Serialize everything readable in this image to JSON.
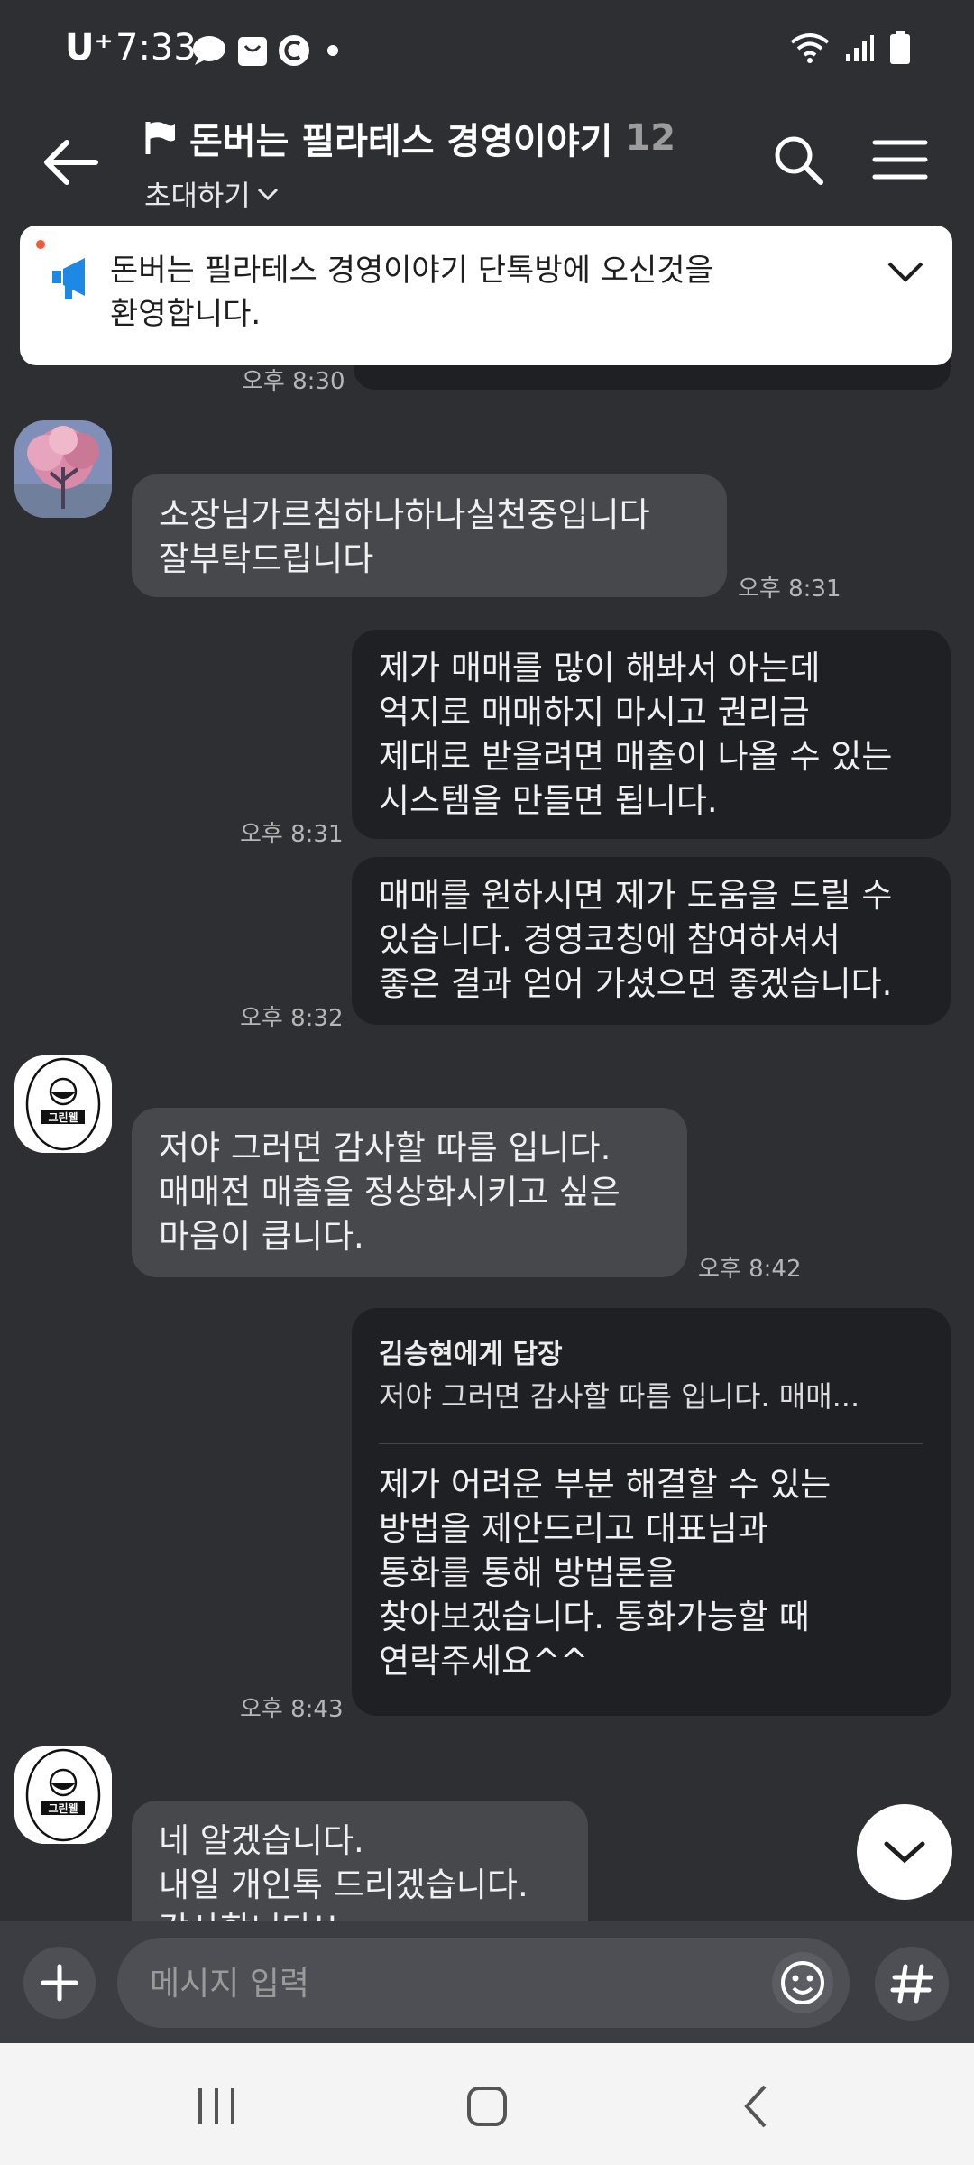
{
  "status_bar": {
    "carrier": "U⁺",
    "time": "7:33",
    "left_icons": [
      "chat-bubble-icon",
      "shopping-bag-icon",
      "c-circle-icon",
      "dot-icon"
    ],
    "right_icons": [
      "wifi-icon",
      "signal-icon",
      "battery-icon"
    ]
  },
  "header": {
    "title": "돈버는 필라테스 경영이야기",
    "member_count": "12",
    "invite_label": "초대하기",
    "icons": [
      "back-arrow-icon",
      "flag-icon",
      "chevron-down-icon",
      "search-icon",
      "menu-icon"
    ]
  },
  "notice": {
    "lines": [
      "돈버는 필라테스 경영이야기 단톡방에 오신것을",
      "환영합니다."
    ],
    "icon": "megaphone-icon",
    "accent": "#1e88e5"
  },
  "messages": [
    {
      "kind": "peek",
      "time": "오후 8:30"
    },
    {
      "kind": "in",
      "lines": [
        "소장님가르침하나하나실천중입니다",
        "잘부탁드립니다"
      ],
      "time": "오후 8:31"
    },
    {
      "kind": "out",
      "lines": [
        "제가 매매를 많이 해봐서 아는데",
        "억지로 매매하지 마시고 권리금",
        "제대로 받을려면 매출이 나올 수 있는",
        "시스템을 만들면 됩니다."
      ],
      "time": "오후 8:31"
    },
    {
      "kind": "out",
      "lines": [
        "매매를 원하시면 제가 도움을 드릴 수",
        "있습니다. 경영코칭에 참여하셔서",
        "좋은 결과 얻어 가셨으면 좋겠습니다."
      ],
      "time": "오후 8:32"
    },
    {
      "kind": "in",
      "lines": [
        "저야 그러면 감사할 따름 입니다.",
        "매매전 매출을 정상화시키고 싶은",
        "마음이 큽니다."
      ],
      "time": "오후 8:42"
    },
    {
      "kind": "out_reply",
      "reply_to": "김승현에게 답장",
      "quote": "저야 그러면 감사할 따름 입니다. 매매...",
      "lines": [
        "제가 어려운 부분 해결할 수 있는",
        "방법을 제안드리고 대표님과",
        "통화를 통해 방법론을",
        "찾아보겠습니다. 통화가능할 때",
        "연락주세요^^"
      ],
      "time": "오후 8:43"
    },
    {
      "kind": "in",
      "lines": [
        "네 알겠습니다.",
        "내일 개인톡 드리겠습니다.",
        "감사합니다!!"
      ]
    }
  ],
  "logo_text": "그린웰",
  "input": {
    "placeholder": "메시지 입력",
    "value": "",
    "icons": [
      "plus-icon",
      "emoji-icon",
      "hash-icon"
    ]
  },
  "nav": {
    "icons": [
      "recent-apps-icon",
      "home-icon",
      "back-icon"
    ]
  }
}
